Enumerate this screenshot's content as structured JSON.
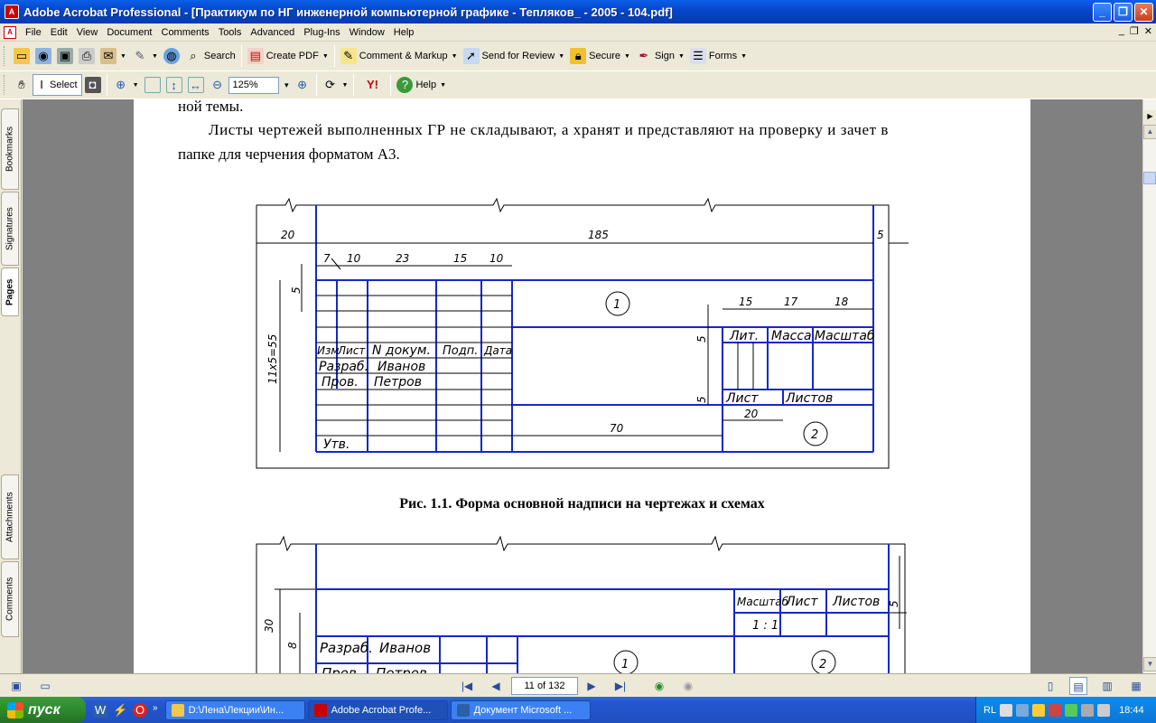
{
  "window": {
    "title": "Adobe Acrobat Professional - [Практикум по НГ инженерной компьютерной графике - Тепляков_ - 2005 - 104.pdf]",
    "app_icon_text": "A"
  },
  "menu": {
    "items": [
      "File",
      "Edit",
      "View",
      "Document",
      "Comments",
      "Tools",
      "Advanced",
      "Plug-Ins",
      "Window",
      "Help"
    ]
  },
  "toolbar1": {
    "search_label": "Search",
    "create_pdf_label": "Create PDF",
    "comment_label": "Comment & Markup",
    "send_review_label": "Send for Review",
    "secure_label": "Secure",
    "sign_label": "Sign",
    "forms_label": "Forms"
  },
  "toolbar2": {
    "select_label": "Select",
    "zoom_value": "125%",
    "help_label": "Help",
    "yahoo_label": "Y!"
  },
  "side_tabs": {
    "bookmarks": "Bookmarks",
    "signatures": "Signatures",
    "pages": "Pages",
    "attachments": "Attachments",
    "comments": "Comments"
  },
  "document": {
    "line1": "ной темы.",
    "line2": "Листы чертежей выполненных ГР не складывают, а хранят и представляют на проверку и зачет в",
    "line3": "папке для черчения форматом А3.",
    "caption": "Рис. 1.1. Форма основной надписи на чертежах и схемах",
    "drawing1": {
      "dims": {
        "d20": "20",
        "d185": "185",
        "d5": "5",
        "d7": "7",
        "d10a": "10",
        "d23": "23",
        "d15a": "15",
        "d10b": "10",
        "d15b": "15",
        "d17": "17",
        "d18": "18",
        "d5v1": "5",
        "d5v2": "5",
        "d5v3": "5",
        "d11x5": "11х5=55",
        "d70": "70",
        "d20b": "20"
      },
      "cells": {
        "izm": "Изм",
        "list": "Лист",
        "ndokum": "N докум.",
        "podp": "Подп.",
        "data": "Дата",
        "razrab": "Разраб.",
        "ivanov": "Иванов",
        "prov": "Пров.",
        "petrov": "Петров",
        "utv": "Утв.",
        "lit": "Лит.",
        "massa": "Масса",
        "masshtab": "Масштаб",
        "list2": "Лист",
        "listov": "Листов",
        "c1": "1",
        "c2": "2"
      }
    },
    "drawing2": {
      "dims": {
        "d30": "30",
        "d8": "8",
        "d5": "5"
      },
      "cells": {
        "masshtab": "Масштаб",
        "list": "Лист",
        "listov": "Листов",
        "scale": "1 : 1",
        "razrab": "Разраб.",
        "ivanov": "Иванов",
        "prov": "Пров.",
        "petrov": "Петров",
        "c1": "1",
        "c2": "2"
      }
    }
  },
  "statusbar": {
    "page_field": "11 of 132"
  },
  "taskbar": {
    "start_label": "пуск",
    "tasks": [
      "D:\\Лена\\Лекции\\Ин...",
      "Adobe Acrobat Profe...",
      "Документ Microsoft ..."
    ],
    "lang": "RL",
    "time": "18:44"
  }
}
